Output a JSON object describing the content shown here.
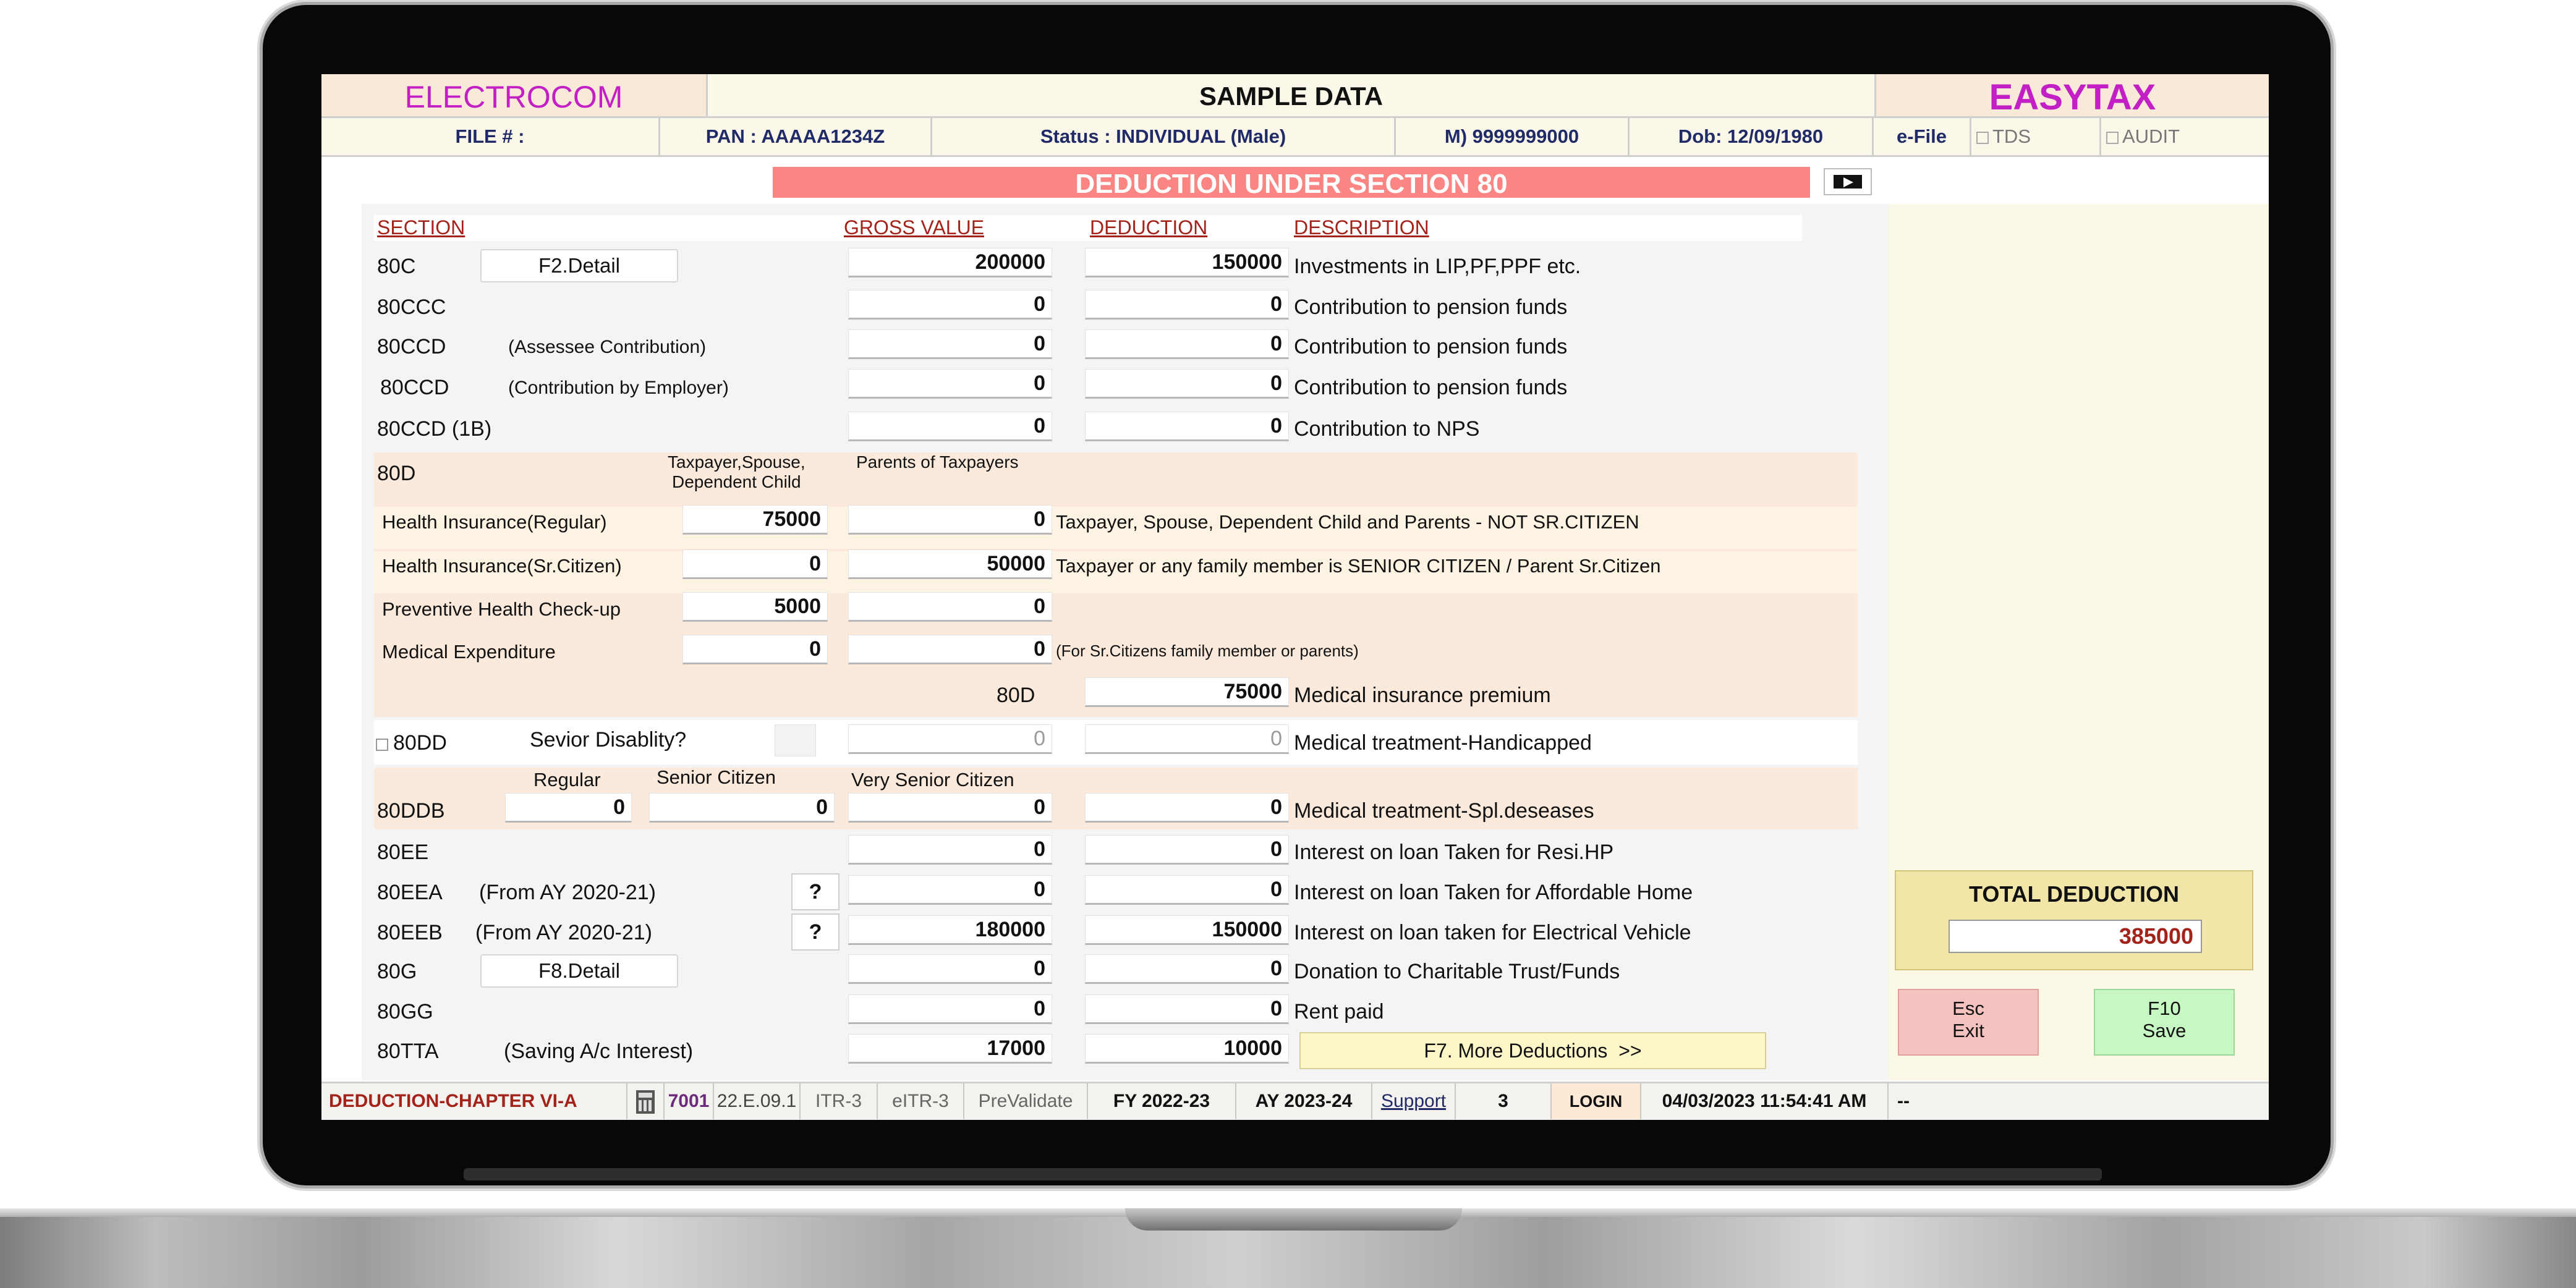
{
  "header": {
    "brand_left": "ELECTROCOM",
    "center_title": "SAMPLE DATA",
    "brand_right": "EASYTAX"
  },
  "info": {
    "file": "FILE # :",
    "pan": "PAN : AAAAA1234Z",
    "status": "Status : INDIVIDUAL (Male)",
    "mobile": "M) 9999999000",
    "dob": "Dob: 12/09/1980",
    "efile": "e-File",
    "tds": "TDS",
    "audit": "AUDIT"
  },
  "page_title": "DEDUCTION UNDER SECTION 80",
  "columns": {
    "section": "SECTION",
    "gross": "GROSS VALUE",
    "deduction": "DEDUCTION",
    "description": "DESCRIPTION"
  },
  "rows": {
    "r80c": {
      "section": "80C",
      "button": "F2.Detail",
      "gross": "200000",
      "deduction": "150000",
      "description": "Investments in LIP,PF,PPF etc."
    },
    "r80ccc": {
      "section": "80CCC",
      "gross": "0",
      "deduction": "0",
      "description": "Contribution to pension funds"
    },
    "r80ccd1": {
      "section": "80CCD",
      "note": "(Assessee Contribution)",
      "gross": "0",
      "deduction": "0",
      "description": "Contribution to pension funds"
    },
    "r80ccd2": {
      "section": "80CCD",
      "note": "(Contribution by Employer)",
      "gross": "0",
      "deduction": "0",
      "description": "Contribution to pension funds"
    },
    "r80ccd1b": {
      "section": "80CCD (1B)",
      "gross": "0",
      "deduction": "0",
      "description": "Contribution to NPS"
    }
  },
  "d80": {
    "section": "80D",
    "col1_line1": "Taxpayer,Spouse,",
    "col1_line2": "Dependent Child",
    "col2": "Parents of Taxpayers",
    "regular": {
      "label": "Health Insurance(Regular)",
      "self": "75000",
      "parents": "0",
      "note": "Taxpayer, Spouse, Dependent Child and Parents - NOT SR.CITIZEN"
    },
    "senior": {
      "label": "Health Insurance(Sr.Citizen)",
      "self": "0",
      "parents": "50000",
      "note": "Taxpayer or any family member is SENIOR CITIZEN / Parent Sr.Citizen"
    },
    "checkup": {
      "label": "Preventive Health Check-up",
      "self": "5000",
      "parents": "0"
    },
    "medical": {
      "label": "Medical Expenditure",
      "self": "0",
      "parents": "0",
      "note": "(For Sr.Citizens family member or parents)"
    },
    "total_label": "80D",
    "total": "75000",
    "description": "Medical insurance premium"
  },
  "dd80": {
    "section": "80DD",
    "question": "Sevior Disablity?",
    "gross": "0",
    "deduction": "0",
    "description": "Medical treatment-Handicapped"
  },
  "ddb80": {
    "section": "80DDB",
    "h_regular": "Regular",
    "h_senior": "Senior Citizen",
    "h_very": "Very Senior Citizen",
    "regular": "0",
    "senior": "0",
    "very": "0",
    "deduction": "0",
    "description": "Medical treatment-Spl.deseases"
  },
  "lower": {
    "r80ee": {
      "section": "80EE",
      "gross": "0",
      "deduction": "0",
      "description": "Interest on loan Taken for Resi.HP"
    },
    "r80eea": {
      "section": "80EEA",
      "note": "(From AY 2020-21)",
      "help": "?",
      "gross": "0",
      "deduction": "0",
      "description": "Interest on loan Taken for Affordable Home"
    },
    "r80eeb": {
      "section": "80EEB",
      "note": "(From AY 2020-21)",
      "help": "?",
      "gross": "180000",
      "deduction": "150000",
      "description": "Interest on loan taken for Electrical Vehicle"
    },
    "r80g": {
      "section": "80G",
      "button": "F8.Detail",
      "gross": "0",
      "deduction": "0",
      "description": "Donation to Charitable Trust/Funds"
    },
    "r80gg": {
      "section": "80GG",
      "gross": "0",
      "deduction": "0",
      "description": "Rent paid"
    },
    "r80tta": {
      "section": "80TTA",
      "note": "(Saving A/c Interest)",
      "gross": "17000",
      "deduction": "10000",
      "more_button": "F7. More Deductions  >>"
    }
  },
  "total_panel": {
    "title": "TOTAL DEDUCTION",
    "value": "385000"
  },
  "actions": {
    "esc_line1": "Esc",
    "esc_line2": "Exit",
    "save_line1": "F10",
    "save_line2": "Save"
  },
  "footer": {
    "module": "DEDUCTION-CHAPTER VI-A",
    "code": "7001",
    "version": "22.E.09.1",
    "itr": "ITR-3",
    "eitr": "eITR-3",
    "prevalidate": "PreValidate",
    "fy": "FY 2022-23",
    "ay": "AY 2023-24",
    "support": "Support",
    "count": "3",
    "login": "LOGIN",
    "datetime": "04/03/2023 11:54:41 AM",
    "extra": "--"
  },
  "colors": {
    "brand": "#c21fc4",
    "title_band": "#fb8583",
    "accent_red": "#a3231b",
    "total_panel": "#f1e6a8",
    "esc": "#f5c3bf",
    "save": "#c7f7c2"
  }
}
